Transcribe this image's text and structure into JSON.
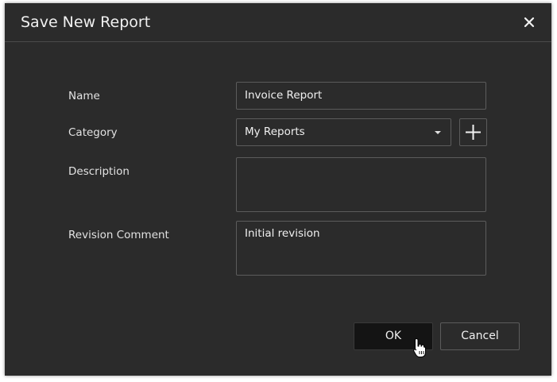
{
  "dialog": {
    "title": "Save New Report",
    "close_icon": "close-icon"
  },
  "form": {
    "name_label": "Name",
    "name_value": "Invoice Report",
    "category_label": "Category",
    "category_value": "My Reports",
    "add_category_icon": "plus-icon",
    "description_label": "Description",
    "description_value": "",
    "revision_label": "Revision Comment",
    "revision_value": "Initial revision"
  },
  "buttons": {
    "ok_label": "OK",
    "cancel_label": "Cancel"
  },
  "colors": {
    "dialog_bg": "#2b2b2b",
    "border": "#5c5c5c",
    "ok_bg": "#141414",
    "text": "#f0f0f0"
  }
}
